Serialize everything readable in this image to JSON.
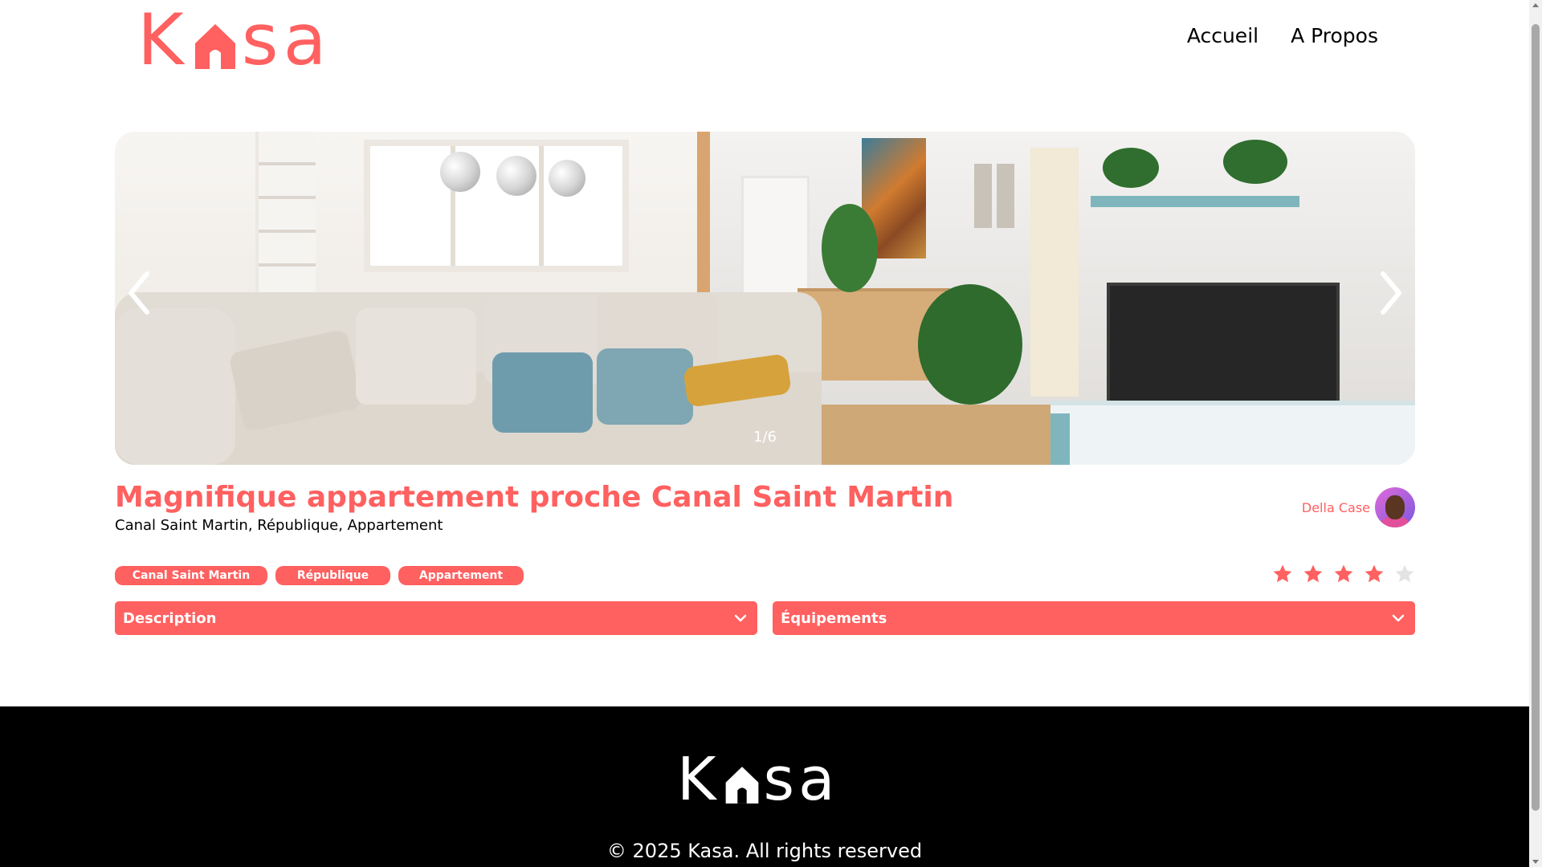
{
  "brand": {
    "logo_left": "K",
    "logo_right": "sa",
    "logo_icon": "house-icon",
    "accent": "#FF6060"
  },
  "nav": {
    "items": [
      {
        "label": "Accueil"
      },
      {
        "label": "A Propos"
      }
    ]
  },
  "carousel": {
    "current": 1,
    "total": 6,
    "counter": "1/6",
    "prev_icon": "chevron-left-icon",
    "next_icon": "chevron-right-icon"
  },
  "listing": {
    "title": "Magnifique appartement proche Canal Saint Martin",
    "location": "Canal Saint Martin, République, Appartement",
    "host": {
      "name": "Della Case"
    },
    "tags": [
      "Canal Saint Martin",
      "République",
      "Appartement"
    ],
    "rating": 4,
    "rating_max": 5
  },
  "collapses": {
    "description": {
      "label": "Description"
    },
    "equipment": {
      "label": "Équipements"
    }
  },
  "footer": {
    "copyright": "© 2025 Kasa. All rights reserved"
  }
}
